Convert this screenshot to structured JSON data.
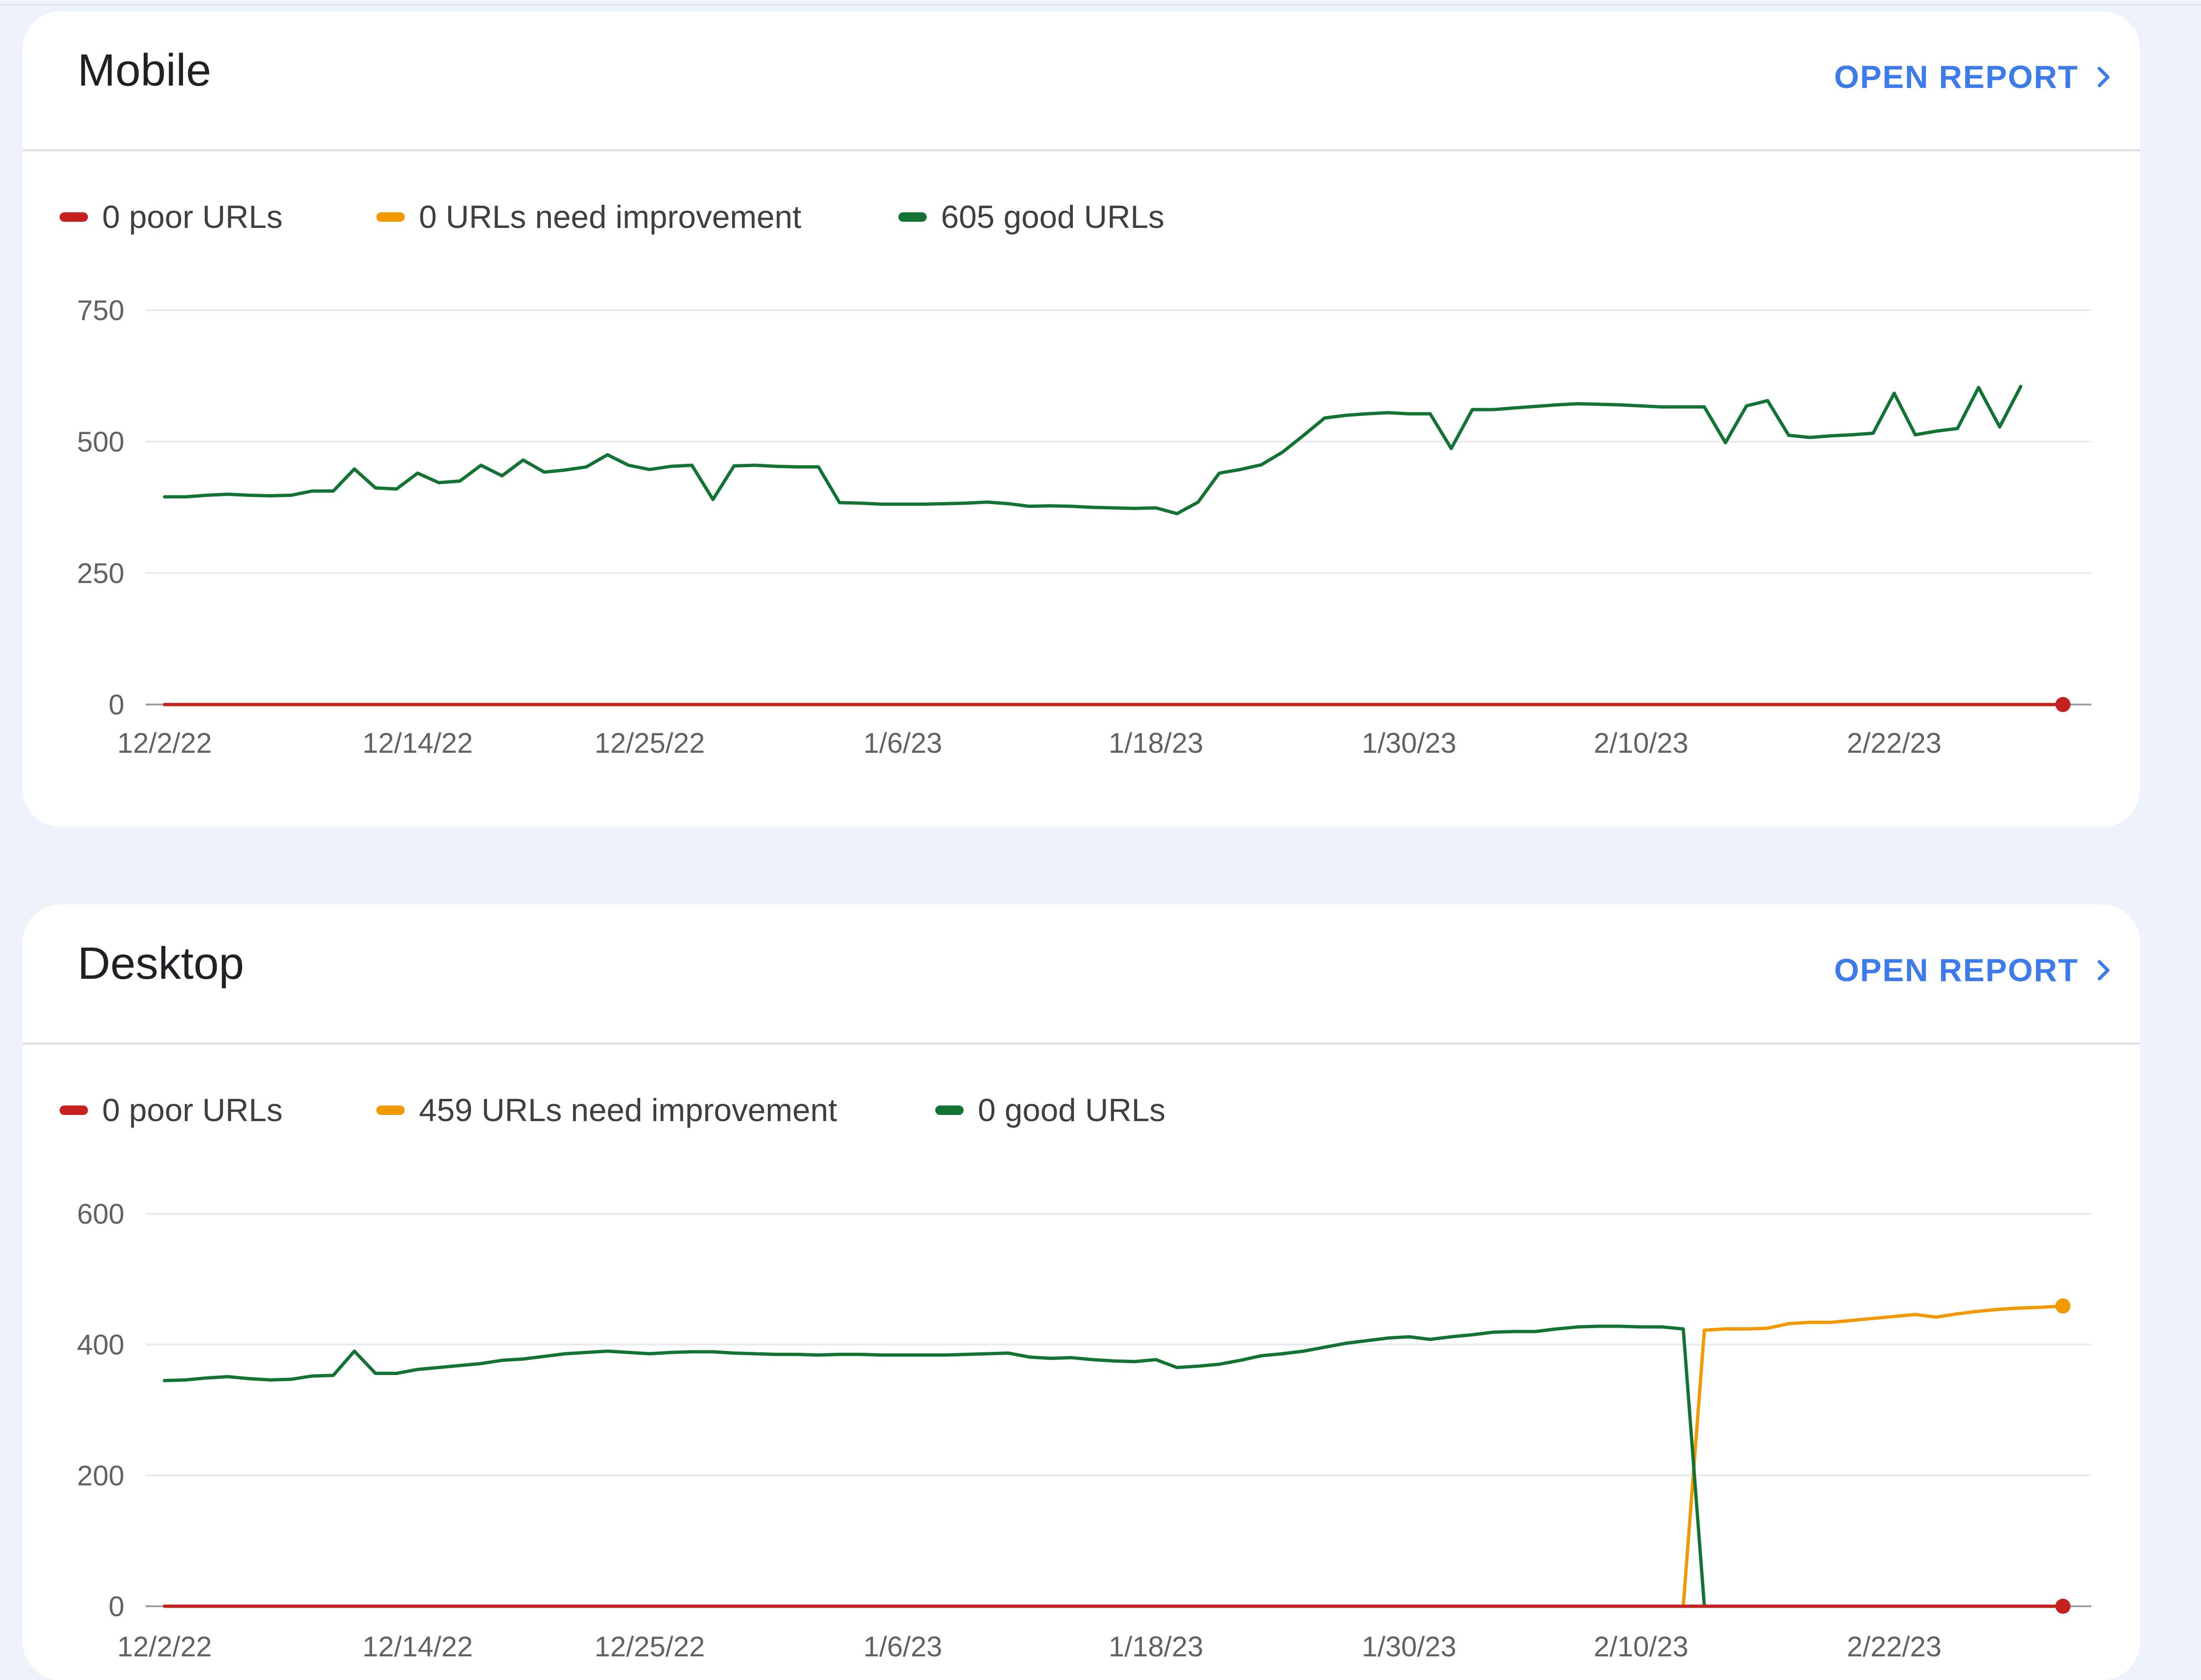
{
  "cards": [
    {
      "title": "Mobile",
      "action_label": "OPEN REPORT",
      "legend": [
        "0 poor URLs",
        "0 URLs need improvement",
        "605 good URLs"
      ]
    },
    {
      "title": "Desktop",
      "action_label": "OPEN REPORT",
      "legend": [
        "0 poor URLs",
        "459 URLs need improvement",
        "0 good URLs"
      ]
    }
  ],
  "colors": {
    "poor": "#c5221f",
    "needs_improvement": "#f29900",
    "good": "#137333",
    "accent": "#3e7bea",
    "grid": "#e8eaed"
  },
  "chart_data": [
    {
      "type": "line",
      "title": "Mobile",
      "x_ticks": [
        "12/2/22",
        "12/14/22",
        "12/25/22",
        "1/6/23",
        "1/18/23",
        "1/30/23",
        "2/10/23",
        "2/22/23"
      ],
      "y_ticks": [
        0,
        250,
        500,
        750
      ],
      "ylim": [
        0,
        750
      ],
      "xlim": [
        "2022-12-02",
        "2023-03-02"
      ],
      "grid": true,
      "legend_position": "top-left",
      "series": [
        {
          "name": "0 poor URLs",
          "color": "#c5221f",
          "values": [
            0,
            0,
            0,
            0,
            0,
            0,
            0,
            0,
            0,
            0,
            0,
            0,
            0,
            0,
            0,
            0,
            0,
            0,
            0,
            0,
            0,
            0,
            0,
            0,
            0,
            0,
            0,
            0,
            0,
            0,
            0,
            0,
            0,
            0,
            0,
            0,
            0,
            0,
            0,
            0,
            0,
            0,
            0,
            0,
            0,
            0,
            0,
            0,
            0,
            0,
            0,
            0,
            0,
            0,
            0,
            0,
            0,
            0,
            0,
            0,
            0,
            0,
            0,
            0,
            0,
            0,
            0,
            0,
            0,
            0,
            0,
            0,
            0,
            0,
            0,
            0,
            0,
            0,
            0,
            0,
            0,
            0,
            0,
            0,
            0,
            0,
            0,
            0,
            0,
            0,
            0
          ]
        },
        {
          "name": "0 URLs need improvement",
          "color": "#f29900",
          "values": [
            0,
            0,
            0,
            0,
            0,
            0,
            0,
            0,
            0,
            0,
            0,
            0,
            0,
            0,
            0,
            0,
            0,
            0,
            0,
            0,
            0,
            0,
            0,
            0,
            0,
            0,
            0,
            0,
            0,
            0,
            0,
            0,
            0,
            0,
            0,
            0,
            0,
            0,
            0,
            0,
            0,
            0,
            0,
            0,
            0,
            0,
            0,
            0,
            0,
            0,
            0,
            0,
            0,
            0,
            0,
            0,
            0,
            0,
            0,
            0,
            0,
            0,
            0,
            0,
            0,
            0,
            0,
            0,
            0,
            0,
            0,
            0,
            0,
            0,
            0,
            0,
            0,
            0,
            0,
            0,
            0,
            0,
            0,
            0,
            0,
            0,
            0,
            0,
            0,
            0,
            0
          ]
        },
        {
          "name": "605 good URLs",
          "color": "#137333",
          "values": [
            395,
            395,
            398,
            400,
            398,
            397,
            398,
            406,
            406,
            448,
            412,
            410,
            440,
            422,
            425,
            455,
            435,
            465,
            442,
            446,
            452,
            475,
            455,
            447,
            453,
            455,
            390,
            454,
            455,
            453,
            452,
            452,
            384,
            383,
            381,
            381,
            381,
            382,
            383,
            385,
            382,
            377,
            378,
            377,
            375,
            374,
            373,
            374,
            363,
            385,
            440,
            447,
            456,
            480,
            512,
            545,
            550,
            553,
            555,
            553,
            553,
            487,
            561,
            561,
            564,
            567,
            570,
            572,
            571,
            570,
            568,
            566,
            566,
            566,
            498,
            568,
            578,
            512,
            508,
            511,
            513,
            516,
            592,
            513,
            520,
            525,
            603,
            528,
            605
          ]
        }
      ]
    },
    {
      "type": "line",
      "title": "Desktop",
      "x_ticks": [
        "12/2/22",
        "12/14/22",
        "12/25/22",
        "1/6/23",
        "1/18/23",
        "1/30/23",
        "2/10/23",
        "2/22/23"
      ],
      "y_ticks": [
        0,
        200,
        400,
        600
      ],
      "ylim": [
        0,
        600
      ],
      "xlim": [
        "2022-12-02",
        "2023-03-02"
      ],
      "grid": true,
      "legend_position": "top-left",
      "series": [
        {
          "name": "0 poor URLs",
          "color": "#c5221f",
          "values": [
            0,
            0,
            0,
            0,
            0,
            0,
            0,
            0,
            0,
            0,
            0,
            0,
            0,
            0,
            0,
            0,
            0,
            0,
            0,
            0,
            0,
            0,
            0,
            0,
            0,
            0,
            0,
            0,
            0,
            0,
            0,
            0,
            0,
            0,
            0,
            0,
            0,
            0,
            0,
            0,
            0,
            0,
            0,
            0,
            0,
            0,
            0,
            0,
            0,
            0,
            0,
            0,
            0,
            0,
            0,
            0,
            0,
            0,
            0,
            0,
            0,
            0,
            0,
            0,
            0,
            0,
            0,
            0,
            0,
            0,
            0,
            0,
            0,
            0,
            0,
            0,
            0,
            0,
            0,
            0,
            0,
            0,
            0,
            0,
            0,
            0,
            0,
            0,
            0,
            0,
            0
          ]
        },
        {
          "name": "459 URLs need improvement",
          "color": "#f29900",
          "values": [
            0,
            0,
            0,
            0,
            0,
            0,
            0,
            0,
            0,
            0,
            0,
            0,
            0,
            0,
            0,
            0,
            0,
            0,
            0,
            0,
            0,
            0,
            0,
            0,
            0,
            0,
            0,
            0,
            0,
            0,
            0,
            0,
            0,
            0,
            0,
            0,
            0,
            0,
            0,
            0,
            0,
            0,
            0,
            0,
            0,
            0,
            0,
            0,
            0,
            0,
            0,
            0,
            0,
            0,
            0,
            0,
            0,
            0,
            0,
            0,
            0,
            0,
            0,
            0,
            0,
            0,
            0,
            0,
            0,
            0,
            0,
            0,
            0,
            422,
            424,
            424,
            425,
            432,
            434,
            434,
            437,
            440,
            443,
            446,
            442,
            447,
            451,
            454,
            456,
            457,
            459
          ]
        },
        {
          "name": "0 good URLs",
          "color": "#137333",
          "values": [
            345,
            346,
            349,
            351,
            348,
            346,
            347,
            352,
            353,
            390,
            356,
            356,
            362,
            365,
            368,
            371,
            376,
            378,
            382,
            386,
            388,
            390,
            388,
            386,
            388,
            389,
            389,
            387,
            386,
            385,
            385,
            384,
            385,
            385,
            384,
            384,
            384,
            384,
            385,
            386,
            387,
            381,
            379,
            380,
            377,
            375,
            374,
            377,
            365,
            367,
            370,
            376,
            383,
            386,
            390,
            396,
            402,
            406,
            410,
            412,
            408,
            412,
            415,
            419,
            420,
            420,
            424,
            427,
            428,
            428,
            427,
            427,
            424,
            0,
            0,
            0,
            0,
            0,
            0,
            0,
            0,
            0,
            0,
            0,
            0,
            0,
            0,
            0,
            0,
            0,
            0
          ]
        }
      ]
    }
  ]
}
